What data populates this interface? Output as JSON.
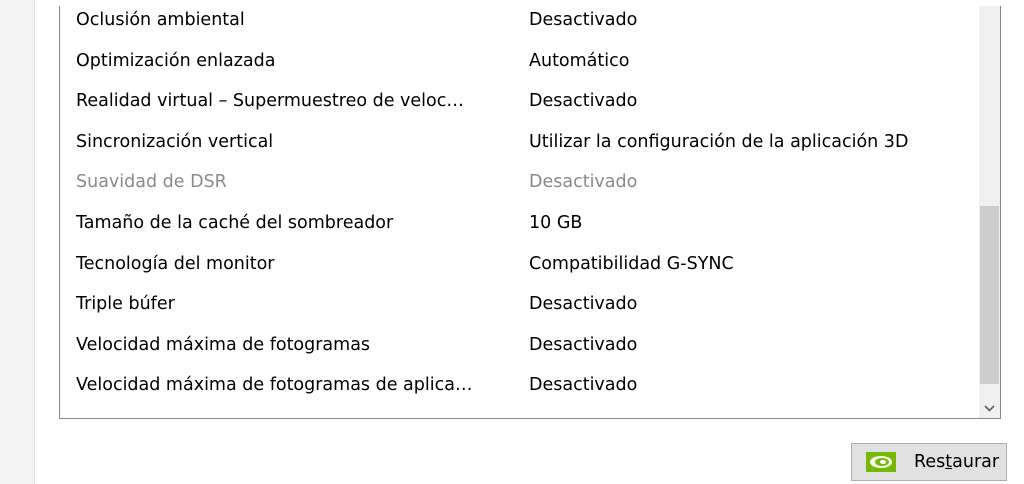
{
  "settings_list": {
    "rows": [
      {
        "name": "Oclusión ambiental",
        "value": "Desactivado",
        "enabled": true
      },
      {
        "name": "Optimización enlazada",
        "value": "Automático",
        "enabled": true
      },
      {
        "name": "Realidad virtual – Supermuestreo de veloc…",
        "value": "Desactivado",
        "enabled": true
      },
      {
        "name": "Sincronización vertical",
        "value": "Utilizar la configuración de la aplicación 3D",
        "enabled": true
      },
      {
        "name": "Suavidad de DSR",
        "value": "Desactivado",
        "enabled": false
      },
      {
        "name": "Tamaño de la caché del sombreador",
        "value": "10 GB",
        "enabled": true
      },
      {
        "name": "Tecnología del monitor",
        "value": "Compatibilidad G-SYNC",
        "enabled": true
      },
      {
        "name": "Triple búfer",
        "value": "Desactivado",
        "enabled": true
      },
      {
        "name": "Velocidad máxima de fotogramas",
        "value": "Desactivado",
        "enabled": true
      },
      {
        "name": "Velocidad máxima de fotogramas de aplica…",
        "value": "Desactivado",
        "enabled": true
      }
    ]
  },
  "scrollbar": {
    "position_fraction": 0.72,
    "down_arrow_icon": "chevron-down-icon"
  },
  "restore_button": {
    "label_prefix": "Res",
    "label_underlined": "t",
    "label_suffix": "aurar",
    "icon": "nvidia-logo-icon"
  },
  "colors": {
    "disabled_text": "#8a8a8a",
    "nvidia_green": "#76b900"
  }
}
